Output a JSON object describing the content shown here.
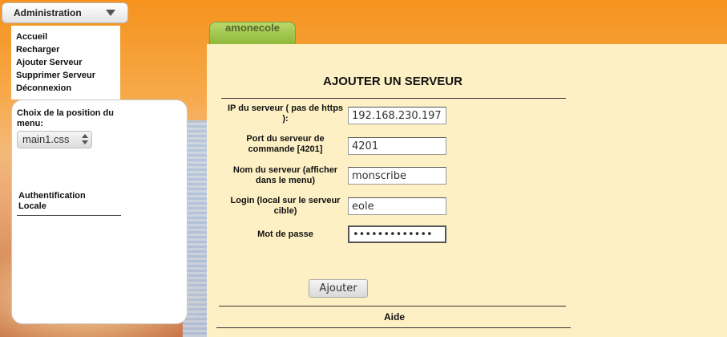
{
  "admin_menu": {
    "label": "Administration",
    "items": [
      "Accueil",
      "Recharger",
      "Ajouter Serveur",
      "Supprimer Serveur",
      "Déconnexion"
    ]
  },
  "left_panel": {
    "position_label": "Choix de la position du menu:",
    "css_select_value": "main1.css",
    "auth_link": "Authentification Locale"
  },
  "tab": {
    "label": "amonecole"
  },
  "form": {
    "title": "AJOUTER UN SERVEUR",
    "fields": [
      {
        "label": "IP du serveur ( pas de https ):",
        "value": "192.168.230.197"
      },
      {
        "label": "Port du serveur de commande [4201]",
        "value": "4201"
      },
      {
        "label": "Nom du serveur (afficher dans le menu)",
        "value": "monscribe"
      },
      {
        "label": "Login (local sur le serveur cible)",
        "value": "eole"
      },
      {
        "label": "Mot de passe",
        "value": "•••••••••••••"
      }
    ],
    "submit_label": "Ajouter",
    "help_label": "Aide"
  },
  "colors": {
    "background_orange": "#f7931e",
    "content_bg": "#fdf0c4",
    "tab_green": "#8db83a"
  }
}
